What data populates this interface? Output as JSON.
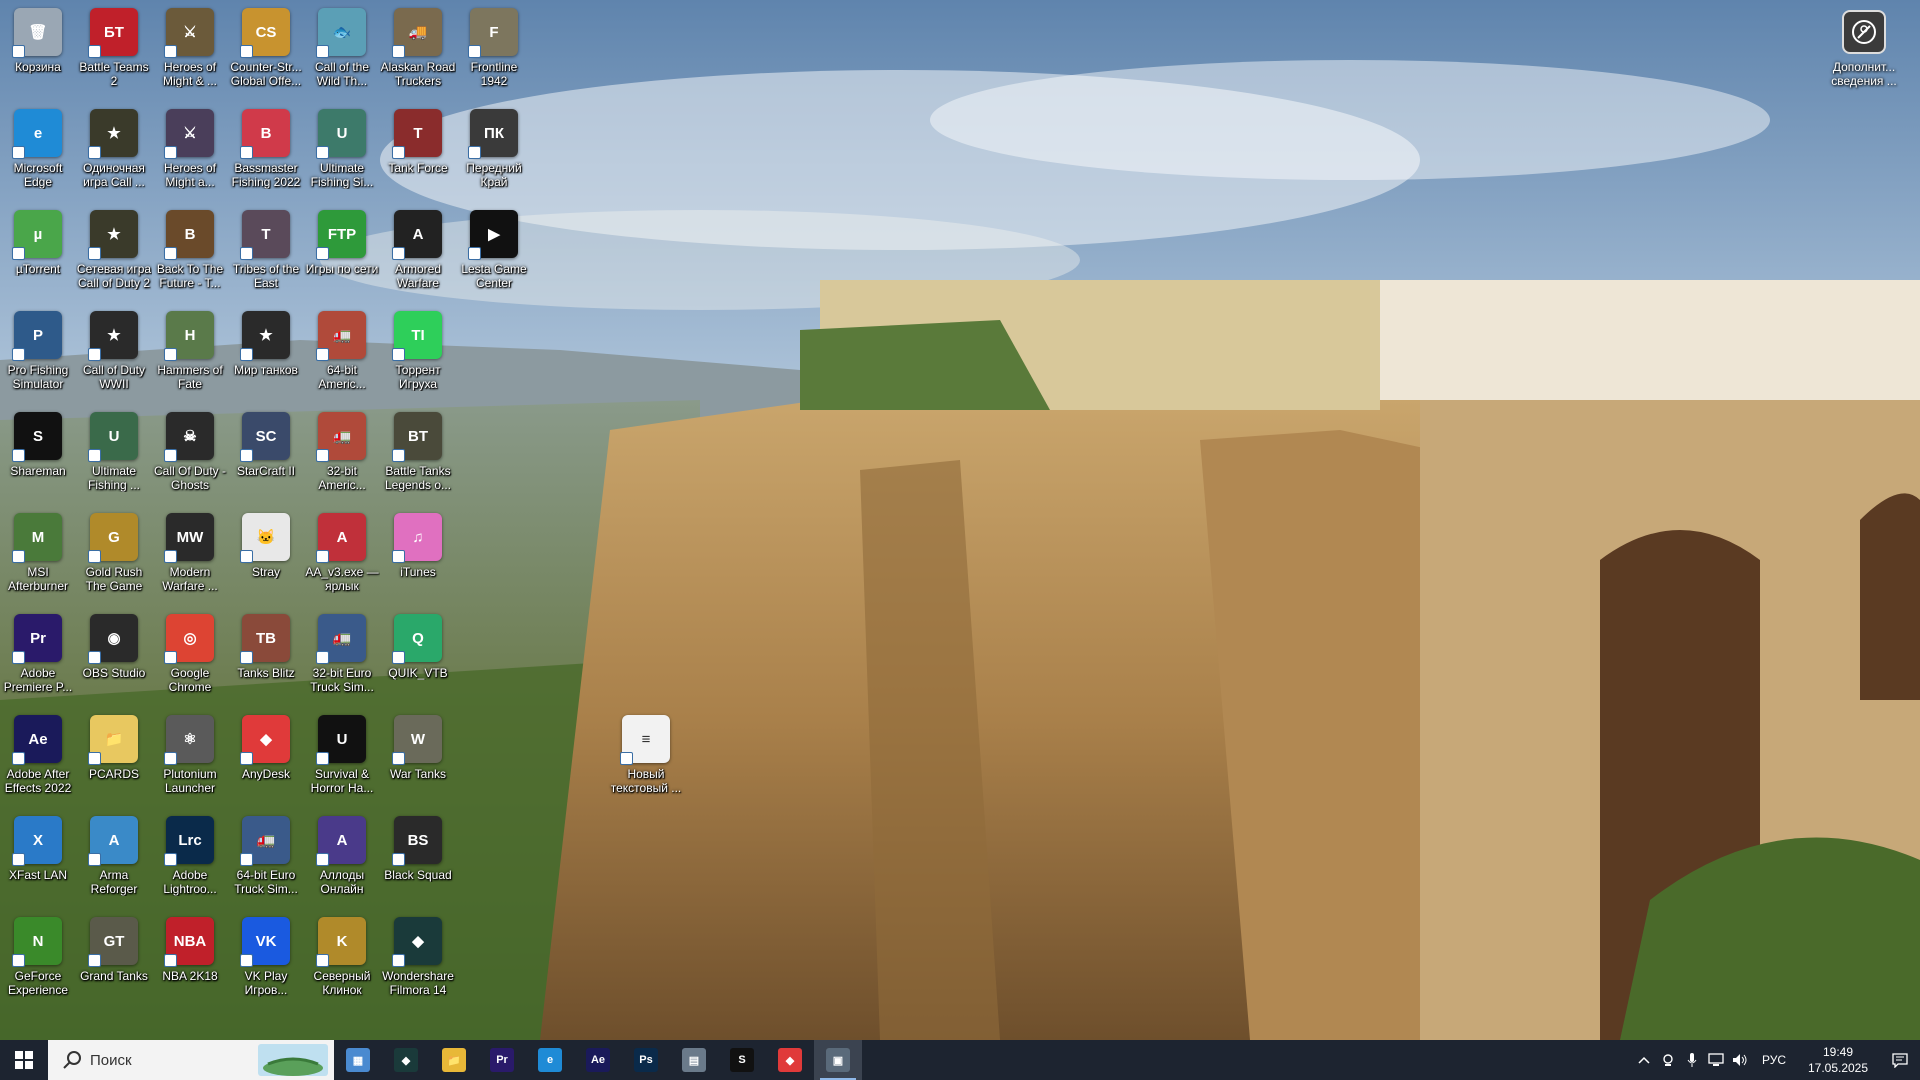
{
  "desktop": {
    "icons": [
      {
        "label": "Корзина",
        "color": "#9aa7b4",
        "glyph": "🗑"
      },
      {
        "label": "Battle Teams 2",
        "color": "#c0202a",
        "glyph": "БT"
      },
      {
        "label": "Heroes of Might & ...",
        "color": "#6b5a3a",
        "glyph": "⚔"
      },
      {
        "label": "Counter-Str... Global Offe...",
        "color": "#c8932f",
        "glyph": "CS"
      },
      {
        "label": "Call of the Wild Th...",
        "color": "#5b9fb6",
        "glyph": "🐟"
      },
      {
        "label": "Alaskan Road Truckers",
        "color": "#7a6a4e",
        "glyph": "🚚"
      },
      {
        "label": "Frontline 1942",
        "color": "#7d765e",
        "glyph": "F"
      },
      {
        "label": "Microsoft Edge",
        "color": "#1f8bd6",
        "glyph": "e"
      },
      {
        "label": "Одиночная игра Call ...",
        "color": "#3a3a2a",
        "glyph": "★"
      },
      {
        "label": "Heroes of Might a...",
        "color": "#4a3e5a",
        "glyph": "⚔"
      },
      {
        "label": "Bassmaster Fishing 2022",
        "color": "#d03a4a",
        "glyph": "B"
      },
      {
        "label": "Ultimate Fishing Si...",
        "color": "#3d7a6a",
        "glyph": "U"
      },
      {
        "label": "Tank Force",
        "color": "#8a2c2c",
        "glyph": "T"
      },
      {
        "label": "Передний Край",
        "color": "#3a3a3a",
        "glyph": "ПК"
      },
      {
        "label": "µTorrent",
        "color": "#4aa64a",
        "glyph": "µ"
      },
      {
        "label": "Сетевая игра Call of Duty 2",
        "color": "#3a3a2a",
        "glyph": "★"
      },
      {
        "label": "Back To The Future - T...",
        "color": "#6a4a2a",
        "glyph": "B"
      },
      {
        "label": "Tribes of the East",
        "color": "#5a4a5a",
        "glyph": "T"
      },
      {
        "label": "Игры по сети",
        "color": "#2e9a3a",
        "glyph": "FTP"
      },
      {
        "label": "Armored Warfare",
        "color": "#222222",
        "glyph": "A"
      },
      {
        "label": "Lesta Game Center",
        "color": "#111111",
        "glyph": "▶"
      },
      {
        "label": "Pro Fishing Simulator",
        "color": "#2e5a8a",
        "glyph": "P"
      },
      {
        "label": "Call of Duty WWII",
        "color": "#2a2a2a",
        "glyph": "★"
      },
      {
        "label": "Hammers of Fate",
        "color": "#5a7a4a",
        "glyph": "H"
      },
      {
        "label": "Мир танков",
        "color": "#2a2a2a",
        "glyph": "★"
      },
      {
        "label": "64-bit Americ...",
        "color": "#b04a3a",
        "glyph": "🚛"
      },
      {
        "label": "Торрент Игруха",
        "color": "#2ecf5a",
        "glyph": "TI"
      },
      null,
      {
        "label": "Shareman",
        "color": "#111111",
        "glyph": "S"
      },
      {
        "label": "Ultimate Fishing ...",
        "color": "#3a6a4a",
        "glyph": "U"
      },
      {
        "label": "Call Of Duty - Ghosts",
        "color": "#2a2a2a",
        "glyph": "☠"
      },
      {
        "label": "StarCraft II",
        "color": "#3a4a6a",
        "glyph": "SC"
      },
      {
        "label": "32-bit Americ...",
        "color": "#b04a3a",
        "glyph": "🚛"
      },
      {
        "label": "Battle Tanks Legends o...",
        "color": "#4a4a3a",
        "glyph": "BT"
      },
      null,
      {
        "label": "MSI Afterburner",
        "color": "#4a7a3a",
        "glyph": "M"
      },
      {
        "label": "Gold Rush The Game",
        "color": "#b08a2a",
        "glyph": "G"
      },
      {
        "label": "Modern Warfare ...",
        "color": "#2a2a2a",
        "glyph": "MW"
      },
      {
        "label": "Stray",
        "color": "#e8e8e8",
        "glyph": "🐱"
      },
      {
        "label": "AA_v3.exe — ярлык",
        "color": "#c0303a",
        "glyph": "A"
      },
      {
        "label": "iTunes",
        "color": "#e070c0",
        "glyph": "♫"
      },
      null,
      {
        "label": "Adobe Premiere P...",
        "color": "#2a1a6a",
        "glyph": "Pr"
      },
      {
        "label": "OBS Studio",
        "color": "#2a2a2a",
        "glyph": "◉"
      },
      {
        "label": "Google Chrome",
        "color": "#dd4433",
        "glyph": "◎"
      },
      {
        "label": "Tanks Blitz",
        "color": "#8a4a3a",
        "glyph": "TB"
      },
      {
        "label": "32-bit Euro Truck Sim...",
        "color": "#3a5a8a",
        "glyph": "🚛"
      },
      {
        "label": "QUIK_VTB",
        "color": "#2aa86a",
        "glyph": "Q"
      },
      null,
      {
        "label": "Adobe After Effects 2022",
        "color": "#1a1a5a",
        "glyph": "Ae"
      },
      {
        "label": "PCARDS",
        "color": "#e8c860",
        "glyph": "📁"
      },
      {
        "label": "Plutonium Launcher",
        "color": "#5a5a5a",
        "glyph": "⚛"
      },
      {
        "label": "AnyDesk",
        "color": "#e03a3a",
        "glyph": "◆"
      },
      {
        "label": "Survival & Horror Ha...",
        "color": "#111111",
        "glyph": "U"
      },
      {
        "label": "War Tanks",
        "color": "#6a6a5a",
        "glyph": "W"
      },
      {
        "label": "Новый текстовый ...",
        "color": "#f2f2f2",
        "glyph": "≡"
      },
      {
        "label": "XFast LAN",
        "color": "#2a7ac8",
        "glyph": "X"
      },
      {
        "label": "Arma Reforger",
        "color": "#3a8ac8",
        "glyph": "A"
      },
      {
        "label": "Adobe Lightroo...",
        "color": "#0a2a4a",
        "glyph": "Lrc"
      },
      {
        "label": "64-bit Euro Truck Sim...",
        "color": "#3a5a8a",
        "glyph": "🚛"
      },
      {
        "label": "Аллоды Онлайн",
        "color": "#4a3a8a",
        "glyph": "A"
      },
      {
        "label": "Black Squad",
        "color": "#2a2a2a",
        "glyph": "BS"
      },
      null,
      {
        "label": "GeForce Experience",
        "color": "#3a8a2a",
        "glyph": "N"
      },
      {
        "label": "Grand Tanks",
        "color": "#5a5a4a",
        "glyph": "GT"
      },
      {
        "label": "NBA 2K18",
        "color": "#c0202a",
        "glyph": "NBA"
      },
      {
        "label": "VK Play Игров...",
        "color": "#1a5ae0",
        "glyph": "VK"
      },
      {
        "label": "Северный Клинок",
        "color": "#b08a2a",
        "glyph": "K"
      },
      {
        "label": "Wondershare Filmora 14",
        "color": "#1a3a3a",
        "glyph": "◆"
      },
      null
    ],
    "extra_info": {
      "label": "Дополнит... сведения ..."
    }
  },
  "taskbar": {
    "search_placeholder": "Поиск",
    "apps": [
      {
        "name": "task-view",
        "color": "#4a8ad0",
        "glyph": "▦",
        "active": false
      },
      {
        "name": "filmora",
        "color": "#1a3a3a",
        "glyph": "◆",
        "active": false
      },
      {
        "name": "file-explorer",
        "color": "#e8b838",
        "glyph": "📁",
        "active": false
      },
      {
        "name": "premiere",
        "color": "#2a1a6a",
        "glyph": "Pr",
        "active": false
      },
      {
        "name": "edge",
        "color": "#1f8bd6",
        "glyph": "e",
        "active": false
      },
      {
        "name": "after-effects",
        "color": "#1a1a5a",
        "glyph": "Ae",
        "active": false
      },
      {
        "name": "photoshop",
        "color": "#0a2a4a",
        "glyph": "Ps",
        "active": false
      },
      {
        "name": "calculator",
        "color": "#6a7a8a",
        "glyph": "▤",
        "active": false
      },
      {
        "name": "shareman",
        "color": "#111111",
        "glyph": "S",
        "active": false
      },
      {
        "name": "anydesk",
        "color": "#e03a3a",
        "glyph": "◆",
        "active": false
      },
      {
        "name": "game-app",
        "color": "#5a6a7a",
        "glyph": "▣",
        "active": true
      }
    ],
    "tray": {
      "language": "РУС",
      "time": "19:49",
      "date": "17.05.2025"
    }
  }
}
